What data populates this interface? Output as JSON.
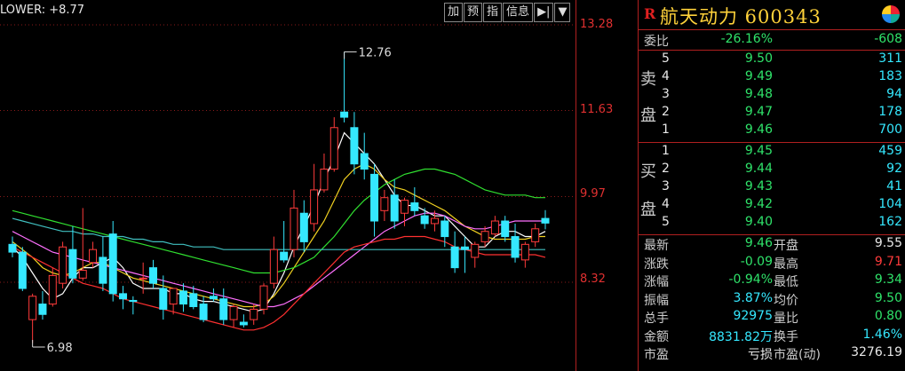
{
  "indicator": {
    "text": "LOWER: +8.77"
  },
  "toolbar": [
    {
      "label": "加",
      "name": "add-button"
    },
    {
      "label": "预",
      "name": "forecast-button"
    },
    {
      "label": "指",
      "name": "indicator-button"
    },
    {
      "label": "信息",
      "name": "info-button"
    },
    {
      "label": "▶|",
      "name": "step-forward-button"
    },
    {
      "label": "▼",
      "name": "dropdown-button"
    }
  ],
  "price_axis": [
    "13.28",
    "11.63",
    "9.97",
    "8.32"
  ],
  "annotations": {
    "high": "12.76",
    "low": "6.98"
  },
  "stock": {
    "marker": "R",
    "name_code": "航天动力 600343"
  },
  "weibi": {
    "label": "委比",
    "pct": "-26.16%",
    "diff": "-608"
  },
  "sell_side": {
    "label_top": "卖",
    "label_bottom": "盘"
  },
  "buy_side": {
    "label_top": "买",
    "label_bottom": "盘"
  },
  "asks": [
    {
      "level": "5",
      "price": "9.50",
      "vol": "311"
    },
    {
      "level": "4",
      "price": "9.49",
      "vol": "183"
    },
    {
      "level": "3",
      "price": "9.48",
      "vol": "94"
    },
    {
      "level": "2",
      "price": "9.47",
      "vol": "178"
    },
    {
      "level": "1",
      "price": "9.46",
      "vol": "700"
    }
  ],
  "bids": [
    {
      "level": "1",
      "price": "9.45",
      "vol": "459"
    },
    {
      "level": "2",
      "price": "9.44",
      "vol": "92"
    },
    {
      "level": "3",
      "price": "9.43",
      "vol": "41"
    },
    {
      "level": "4",
      "price": "9.42",
      "vol": "104"
    },
    {
      "level": "5",
      "price": "9.40",
      "vol": "162"
    }
  ],
  "stats": [
    {
      "l1": "最新",
      "v1": "9.46",
      "l2": "开盘",
      "v2": "9.55",
      "c1": "green",
      "c2": "white"
    },
    {
      "l1": "涨跌",
      "v1": "-0.09",
      "l2": "最高",
      "v2": "9.71",
      "c1": "green",
      "c2": "red"
    },
    {
      "l1": "涨幅",
      "v1": "-0.94%",
      "l2": "最低",
      "v2": "9.34",
      "c1": "green",
      "c2": "green"
    },
    {
      "l1": "振幅",
      "v1": "3.87%",
      "l2": "均价",
      "v2": "9.50",
      "c1": "cyan",
      "c2": "green"
    },
    {
      "l1": "总手",
      "v1": "92975",
      "l2": "量比",
      "v2": "0.80",
      "c1": "cyan",
      "c2": "green"
    },
    {
      "l1": "金额",
      "v1": "8831.82万",
      "l2": "换手",
      "v2": "1.46%",
      "c1": "cyan",
      "c2": "cyan"
    },
    {
      "l1": "市盈",
      "v1": "亏损",
      "l2": "市盈(动)",
      "v2": "3276.19",
      "c1": "white",
      "c2": "white"
    }
  ],
  "colors": {
    "up": "#ff3b3b",
    "down": "#35e8ff",
    "grid": "#8a1a1a",
    "ma_white": "#ffffff",
    "ma_yellow": "#f0d020",
    "ma_magenta": "#ff70ff",
    "ma_green": "#30e030",
    "ma_teal": "#40c0c0",
    "ma_red": "#ff3030"
  },
  "chart_data": {
    "type": "candlestick",
    "ylim": [
      6.9,
      13.5
    ],
    "gridlines": [
      13.28,
      11.63,
      9.97,
      8.32
    ],
    "candles": [
      {
        "o": 9.05,
        "h": 9.2,
        "c": 8.9,
        "l": 8.8
      },
      {
        "o": 8.9,
        "h": 9.0,
        "c": 8.2,
        "l": 8.15
      },
      {
        "o": 7.6,
        "h": 8.1,
        "c": 8.05,
        "l": 7.15
      },
      {
        "o": 7.9,
        "h": 8.15,
        "c": 7.7,
        "l": 7.6
      },
      {
        "o": 7.9,
        "h": 8.6,
        "c": 8.45,
        "l": 7.85
      },
      {
        "o": 8.3,
        "h": 9.1,
        "c": 9.0,
        "l": 8.2
      },
      {
        "o": 8.95,
        "h": 9.4,
        "c": 8.4,
        "l": 8.3
      },
      {
        "o": 8.4,
        "h": 9.75,
        "c": 8.55,
        "l": 8.35
      },
      {
        "o": 8.7,
        "h": 9.1,
        "c": 8.95,
        "l": 8.6
      },
      {
        "o": 8.8,
        "h": 9.2,
        "c": 8.3,
        "l": 8.15
      },
      {
        "o": 9.25,
        "h": 9.5,
        "c": 8.1,
        "l": 7.95
      },
      {
        "o": 8.1,
        "h": 8.25,
        "c": 8.0,
        "l": 7.8
      },
      {
        "o": 7.97,
        "h": 8.05,
        "c": 7.95,
        "l": 7.7
      },
      {
        "o": 8.4,
        "h": 8.7,
        "c": 8.4,
        "l": 8.1
      },
      {
        "o": 8.6,
        "h": 8.75,
        "c": 8.3,
        "l": 8.2
      },
      {
        "o": 8.2,
        "h": 8.45,
        "c": 7.8,
        "l": 7.6
      },
      {
        "o": 7.9,
        "h": 8.1,
        "c": 8.2,
        "l": 7.7
      },
      {
        "o": 8.15,
        "h": 8.3,
        "c": 7.9,
        "l": 7.75
      },
      {
        "o": 8.1,
        "h": 8.25,
        "c": 7.85,
        "l": 7.8
      },
      {
        "o": 7.9,
        "h": 8.05,
        "c": 7.6,
        "l": 7.55
      },
      {
        "o": 8.05,
        "h": 8.2,
        "c": 8.0,
        "l": 7.95
      },
      {
        "o": 8.0,
        "h": 8.2,
        "c": 7.6,
        "l": 7.5
      },
      {
        "o": 7.6,
        "h": 7.9,
        "c": 7.85,
        "l": 7.45
      },
      {
        "o": 7.55,
        "h": 7.7,
        "c": 7.5,
        "l": 7.45
      },
      {
        "o": 7.6,
        "h": 7.9,
        "c": 7.8,
        "l": 7.5
      },
      {
        "o": 7.8,
        "h": 8.3,
        "c": 8.25,
        "l": 7.7
      },
      {
        "o": 8.3,
        "h": 9.2,
        "c": 8.95,
        "l": 8.2
      },
      {
        "o": 8.9,
        "h": 9.5,
        "c": 8.75,
        "l": 8.7
      },
      {
        "o": 8.95,
        "h": 10.1,
        "c": 9.75,
        "l": 8.8
      },
      {
        "o": 9.65,
        "h": 9.9,
        "c": 9.1,
        "l": 8.9
      },
      {
        "o": 9.45,
        "h": 10.6,
        "c": 10.1,
        "l": 9.3
      },
      {
        "o": 10.1,
        "h": 10.8,
        "c": 10.5,
        "l": 10.05
      },
      {
        "o": 10.5,
        "h": 11.5,
        "c": 11.3,
        "l": 10.45
      },
      {
        "o": 11.6,
        "h": 12.76,
        "c": 11.5,
        "l": 11.4
      },
      {
        "o": 11.3,
        "h": 11.6,
        "c": 10.6,
        "l": 10.4
      },
      {
        "o": 10.8,
        "h": 11.2,
        "c": 10.5,
        "l": 10.3
      },
      {
        "o": 10.4,
        "h": 10.6,
        "c": 9.5,
        "l": 9.2
      },
      {
        "o": 9.7,
        "h": 10.1,
        "c": 9.95,
        "l": 9.5
      },
      {
        "o": 10.0,
        "h": 10.3,
        "c": 9.5,
        "l": 9.35
      },
      {
        "o": 9.65,
        "h": 9.95,
        "c": 9.9,
        "l": 9.4
      },
      {
        "o": 9.85,
        "h": 10.15,
        "c": 9.7,
        "l": 9.6
      },
      {
        "o": 9.6,
        "h": 9.75,
        "c": 9.45,
        "l": 9.35
      },
      {
        "o": 9.45,
        "h": 9.7,
        "c": 9.55,
        "l": 9.3
      },
      {
        "o": 9.5,
        "h": 9.6,
        "c": 9.2,
        "l": 9.0
      },
      {
        "o": 9.0,
        "h": 9.3,
        "c": 8.6,
        "l": 8.5
      },
      {
        "o": 9.0,
        "h": 9.2,
        "c": 8.95,
        "l": 8.5
      },
      {
        "o": 8.8,
        "h": 9.1,
        "c": 9.05,
        "l": 8.6
      },
      {
        "o": 9.1,
        "h": 9.4,
        "c": 9.3,
        "l": 9.0
      },
      {
        "o": 9.25,
        "h": 9.6,
        "c": 9.5,
        "l": 9.2
      },
      {
        "o": 9.5,
        "h": 9.6,
        "c": 9.2,
        "l": 9.1
      },
      {
        "o": 9.2,
        "h": 9.45,
        "c": 8.8,
        "l": 8.7
      },
      {
        "o": 8.75,
        "h": 9.1,
        "c": 9.05,
        "l": 8.6
      },
      {
        "o": 9.1,
        "h": 9.45,
        "c": 9.35,
        "l": 9.0
      },
      {
        "o": 9.55,
        "h": 9.71,
        "c": 9.46,
        "l": 9.34
      }
    ],
    "ma_lines": [
      {
        "color": "ma_white",
        "values": [
          9.0,
          8.8,
          8.5,
          8.2,
          8.0,
          8.1,
          8.4,
          8.6,
          8.6,
          8.7,
          8.8,
          8.6,
          8.3,
          8.2,
          8.2,
          8.2,
          8.1,
          8.1,
          8.0,
          7.95,
          7.95,
          7.9,
          7.85,
          7.8,
          7.75,
          7.8,
          8.1,
          8.5,
          9.0,
          9.4,
          9.8,
          10.3,
          10.7,
          11.2,
          11.0,
          10.8,
          10.6,
          10.3,
          10.0,
          9.8,
          9.8,
          9.7,
          9.6,
          9.6,
          9.4,
          9.2,
          9.0,
          9.0,
          9.2,
          9.3,
          9.3,
          9.2,
          9.2,
          9.3
        ]
      },
      {
        "color": "ma_yellow",
        "values": [
          9.1,
          8.95,
          8.8,
          8.6,
          8.5,
          8.45,
          8.5,
          8.6,
          8.7,
          8.7,
          8.6,
          8.5,
          8.4,
          8.35,
          8.3,
          8.25,
          8.2,
          8.15,
          8.1,
          8.05,
          8.0,
          7.95,
          7.9,
          7.85,
          7.85,
          7.9,
          8.05,
          8.3,
          8.6,
          8.9,
          9.2,
          9.5,
          9.9,
          10.3,
          10.5,
          10.6,
          10.5,
          10.3,
          10.15,
          10.1,
          10.0,
          9.9,
          9.8,
          9.7,
          9.55,
          9.4,
          9.3,
          9.2,
          9.15,
          9.15,
          9.15,
          9.15,
          9.2,
          9.2
        ]
      },
      {
        "color": "ma_magenta",
        "values": [
          9.3,
          9.2,
          9.1,
          9.0,
          8.9,
          8.85,
          8.8,
          8.75,
          8.7,
          8.65,
          8.6,
          8.55,
          8.5,
          8.45,
          8.4,
          8.35,
          8.3,
          8.25,
          8.2,
          8.15,
          8.1,
          8.05,
          8.0,
          7.95,
          7.9,
          7.85,
          7.85,
          7.9,
          8.0,
          8.1,
          8.25,
          8.4,
          8.55,
          8.7,
          8.85,
          9.0,
          9.15,
          9.3,
          9.4,
          9.5,
          9.6,
          9.65,
          9.65,
          9.6,
          9.5,
          9.4,
          9.35,
          9.35,
          9.4,
          9.45,
          9.5,
          9.5,
          9.5,
          9.5
        ]
      },
      {
        "color": "ma_green",
        "values": [
          9.7,
          9.65,
          9.6,
          9.55,
          9.5,
          9.45,
          9.4,
          9.35,
          9.3,
          9.25,
          9.2,
          9.15,
          9.1,
          9.05,
          9.0,
          8.95,
          8.9,
          8.85,
          8.8,
          8.75,
          8.7,
          8.65,
          8.6,
          8.55,
          8.5,
          8.5,
          8.5,
          8.55,
          8.6,
          8.7,
          8.8,
          9.0,
          9.2,
          9.45,
          9.7,
          9.9,
          10.05,
          10.2,
          10.3,
          10.4,
          10.45,
          10.5,
          10.5,
          10.45,
          10.4,
          10.3,
          10.2,
          10.1,
          10.05,
          10.0,
          10.0,
          10.0,
          9.95,
          9.95
        ]
      },
      {
        "color": "ma_teal",
        "values": [
          9.55,
          9.5,
          9.45,
          9.4,
          9.35,
          9.3,
          9.3,
          9.25,
          9.25,
          9.2,
          9.2,
          9.2,
          9.15,
          9.15,
          9.1,
          9.1,
          9.05,
          9.05,
          9.0,
          9.0,
          9.0,
          8.95,
          8.95,
          8.95,
          8.95,
          8.95,
          8.95,
          8.95,
          8.95,
          8.95,
          8.95,
          8.95,
          8.95,
          8.95,
          8.95,
          8.95,
          8.95,
          8.95,
          8.95,
          8.95,
          8.95,
          8.95,
          8.95,
          8.95,
          8.95,
          8.95,
          8.95,
          8.95,
          8.95,
          8.95,
          8.95,
          8.95,
          8.95,
          8.95
        ]
      },
      {
        "color": "ma_red",
        "values": [
          9.0,
          8.9,
          8.8,
          8.7,
          8.6,
          8.5,
          8.4,
          8.3,
          8.25,
          8.2,
          8.1,
          8.0,
          7.95,
          7.9,
          7.85,
          7.8,
          7.75,
          7.7,
          7.65,
          7.6,
          7.55,
          7.5,
          7.45,
          7.4,
          7.4,
          7.45,
          7.55,
          7.7,
          7.9,
          8.1,
          8.3,
          8.5,
          8.7,
          8.9,
          9.0,
          9.05,
          9.1,
          9.15,
          9.15,
          9.2,
          9.2,
          9.2,
          9.15,
          9.1,
          9.0,
          8.95,
          8.9,
          8.85,
          8.85,
          8.85,
          8.85,
          8.85,
          8.85,
          8.8
        ]
      }
    ]
  }
}
